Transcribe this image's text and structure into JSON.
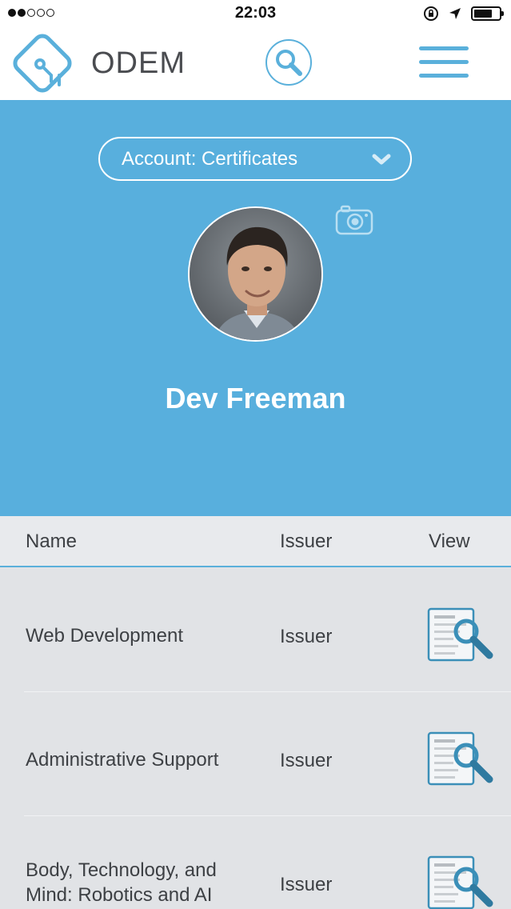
{
  "status_bar": {
    "signal_dots": [
      true,
      true,
      false,
      false,
      false
    ],
    "time": "22:03",
    "icons": [
      "orientation-lock-icon",
      "location-arrow-icon",
      "battery-icon"
    ]
  },
  "navbar": {
    "brand": "ODEM",
    "logo_icon": "odem-logo-icon",
    "search_icon": "search-icon",
    "menu_icon": "hamburger-menu-icon"
  },
  "profile": {
    "account_select": "Account: Certificates",
    "camera_icon": "camera-icon",
    "name": "Dev Freeman"
  },
  "table": {
    "headers": {
      "name": "Name",
      "issuer": "Issuer",
      "view": "View"
    },
    "rows": [
      {
        "name": "Web Development",
        "issuer": "Issuer",
        "view_icon": "view-certificate-icon"
      },
      {
        "name": "Administrative Support",
        "issuer": "Issuer",
        "view_icon": "view-certificate-icon"
      },
      {
        "name": "Body, Technology, and Mind: Robotics and AI",
        "issuer": "Issuer",
        "view_icon": "view-certificate-icon"
      }
    ]
  },
  "colors": {
    "accent": "#58afdd",
    "background": "#e1e3e6",
    "text": "#3d4044"
  }
}
